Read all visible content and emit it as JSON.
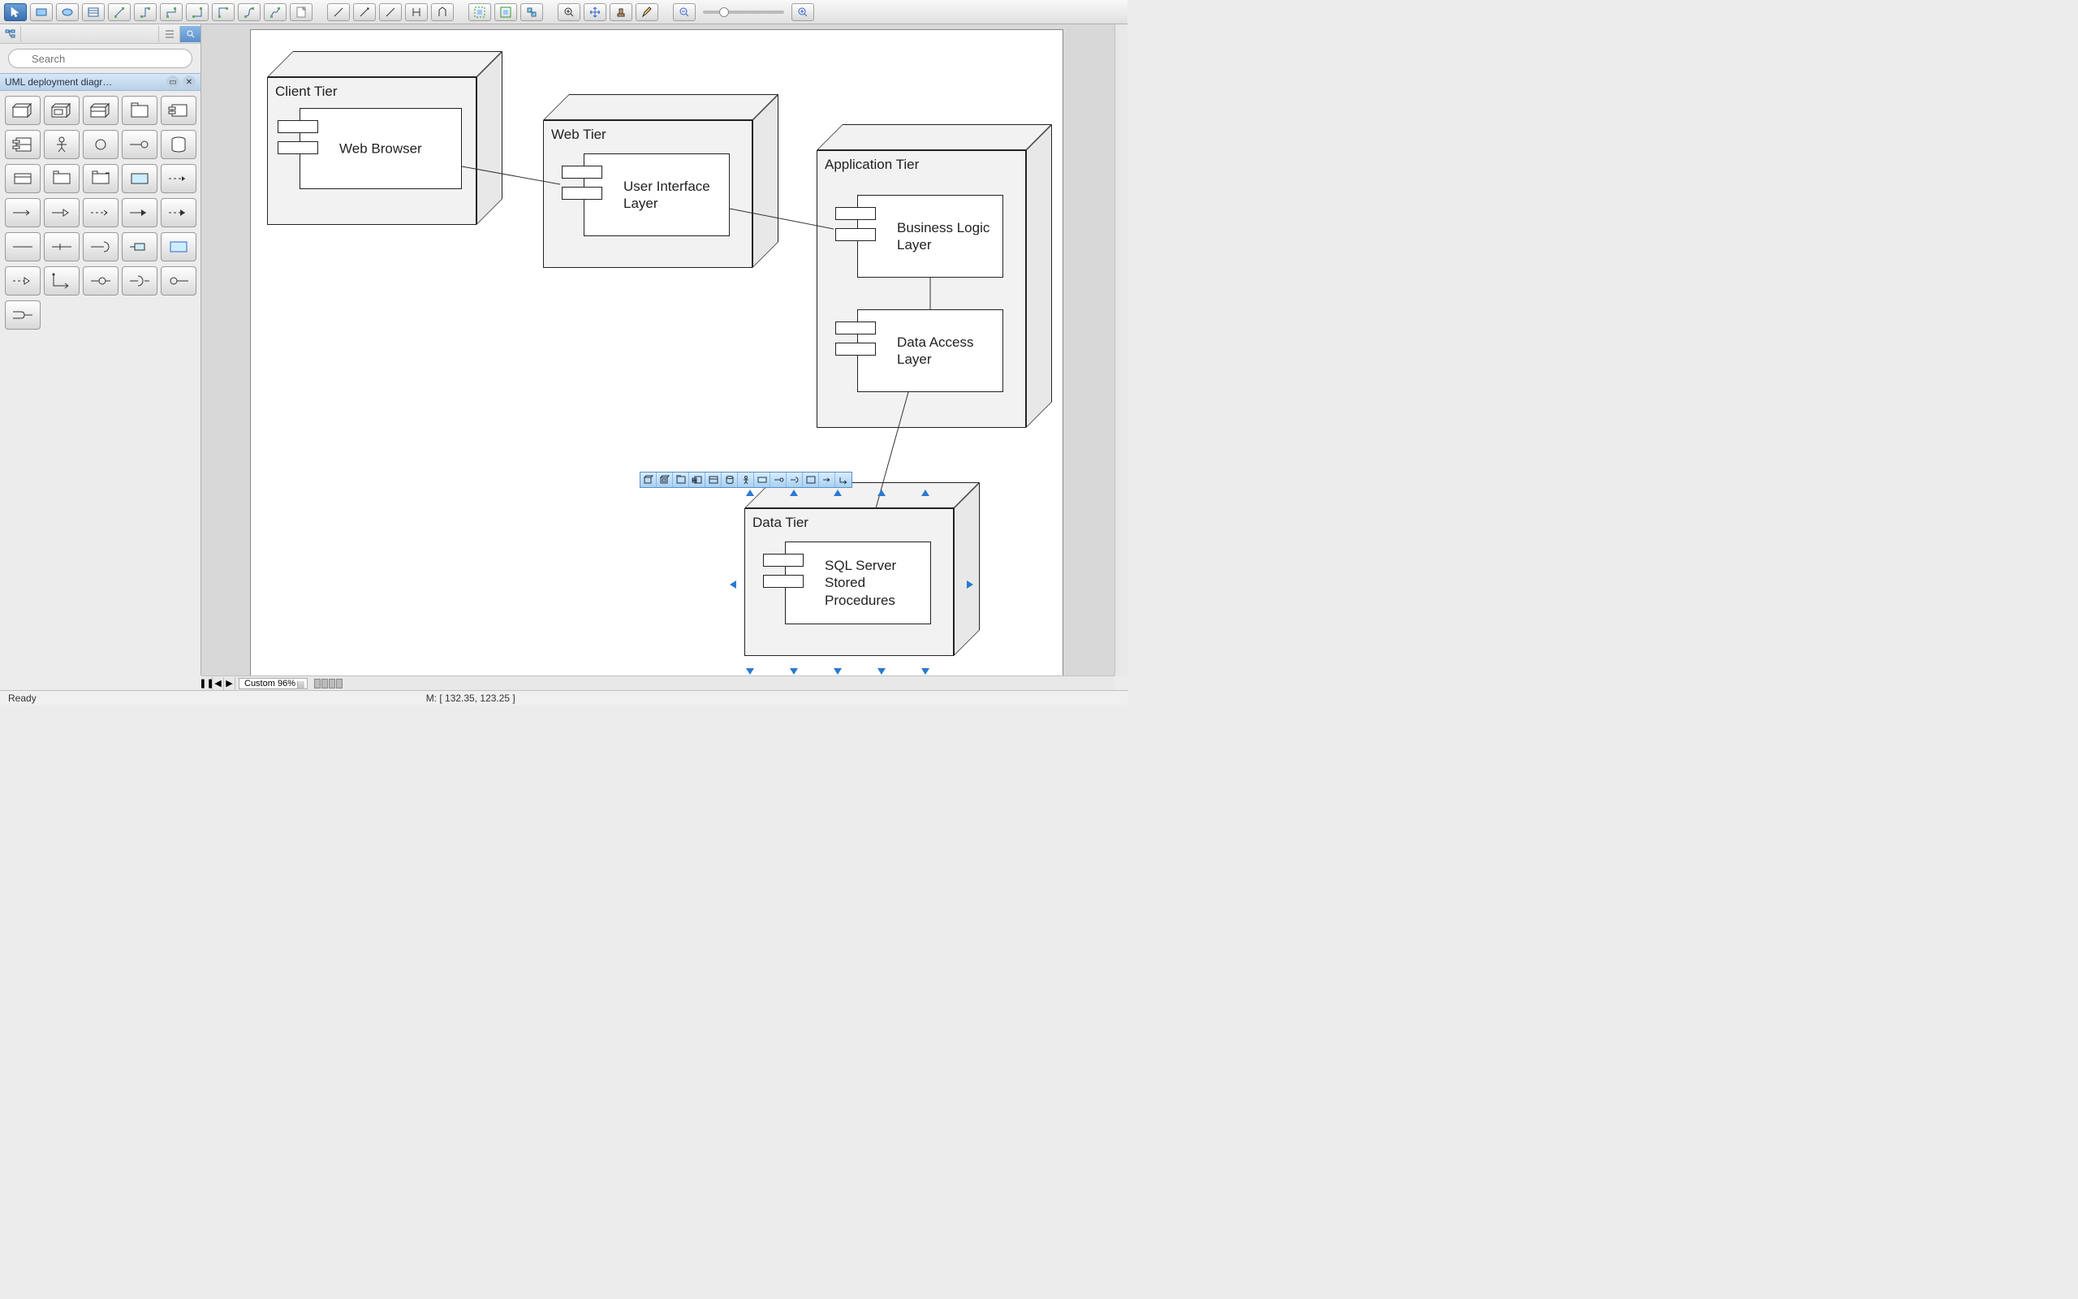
{
  "sidebar": {
    "search_placeholder": "Search",
    "palette_title": "UML deployment diagr…"
  },
  "diagram": {
    "nodes": {
      "client": {
        "title": "Client Tier",
        "component": "Web Browser"
      },
      "web": {
        "title": "Web Tier",
        "component": "User Interface Layer"
      },
      "app": {
        "title": "Application Tier",
        "component1": "Business Logic Layer",
        "component2": "Data Access Layer"
      },
      "data": {
        "title": "Data Tier",
        "component": "SQL Server Stored Procedures"
      }
    }
  },
  "bottom": {
    "zoom_label": "Custom 96%"
  },
  "status": {
    "ready": "Ready",
    "coords": "M: [ 132.35, 123.25 ]"
  }
}
